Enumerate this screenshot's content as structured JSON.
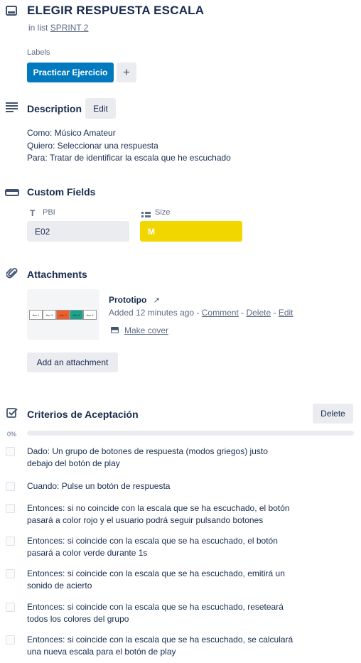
{
  "card": {
    "title": "ELEGIR RESPUESTA ESCALA",
    "in_list_prefix": "in list",
    "list_name": "SPRINT 2"
  },
  "labels": {
    "heading": "Labels",
    "items": [
      "Practicar Ejercicio"
    ],
    "add_symbol": "+"
  },
  "description": {
    "heading": "Description",
    "edit_label": "Edit",
    "lines": [
      "Como: Músico Amateur",
      "Quiero: Seleccionar una respuesta",
      "Para: Tratar de identificar la escala que he escuchado"
    ]
  },
  "custom_fields": {
    "heading": "Custom Fields",
    "fields": [
      {
        "name": "PBI",
        "value": "E02",
        "icon": "text-type-icon"
      },
      {
        "name": "Size",
        "value": "M",
        "icon": "dropdown-list-icon",
        "color": "#f2d600"
      }
    ]
  },
  "attachments": {
    "heading": "Attachments",
    "item": {
      "name": "Prototipo",
      "added_text": "Added 12 minutes ago",
      "sep": " - ",
      "comment_label": "Comment",
      "delete_label": "Delete",
      "edit_label": "Edit",
      "make_cover_label": "Make cover",
      "thumbnail_cells": [
        {
          "text": "Asc 1",
          "color": "#ffffff"
        },
        {
          "text": "Asc 2",
          "color": "#ffffff"
        },
        {
          "text": "Asc 3",
          "color": "#f25c2a"
        },
        {
          "text": "Asc 4",
          "color": "#17a28a"
        },
        {
          "text": "Asc 5",
          "color": "#ffffff"
        }
      ]
    },
    "add_label": "Add an attachment"
  },
  "checklist": {
    "heading": "Criterios de Aceptación",
    "delete_label": "Delete",
    "progress_text": "0%",
    "progress": 0,
    "items": [
      {
        "line1": "Dado: Un grupo de botones de respuesta (modos griegos) justo",
        "line2": "debajo del botón de play"
      },
      {
        "line1": "Cuando: Pulse un botón de respuesta",
        "line2": ""
      },
      {
        "line1": "Entonces: si no coincide con la escala que se ha escuchado, el botón",
        "line2": "pasará a color rojo y el usuario podrá seguir pulsando botones"
      },
      {
        "line1": "Entonces: si coincide con la escala que se ha escuchado, el botón",
        "line2": "pasará a color verde durante 1s"
      },
      {
        "line1": "Entonces: si coincide con la escala que se ha escuchado, emitirá un",
        "line2": "sonido de acierto"
      },
      {
        "line1": "Entonces: si coincide con la escala que se ha escuchado, reseteará",
        "line2": "todos los colores del grupo"
      },
      {
        "line1": "Entonces: si coincide con la escala que se ha escuchado, se calculará",
        "line2": "una nueva escala para el botón de play"
      }
    ]
  }
}
